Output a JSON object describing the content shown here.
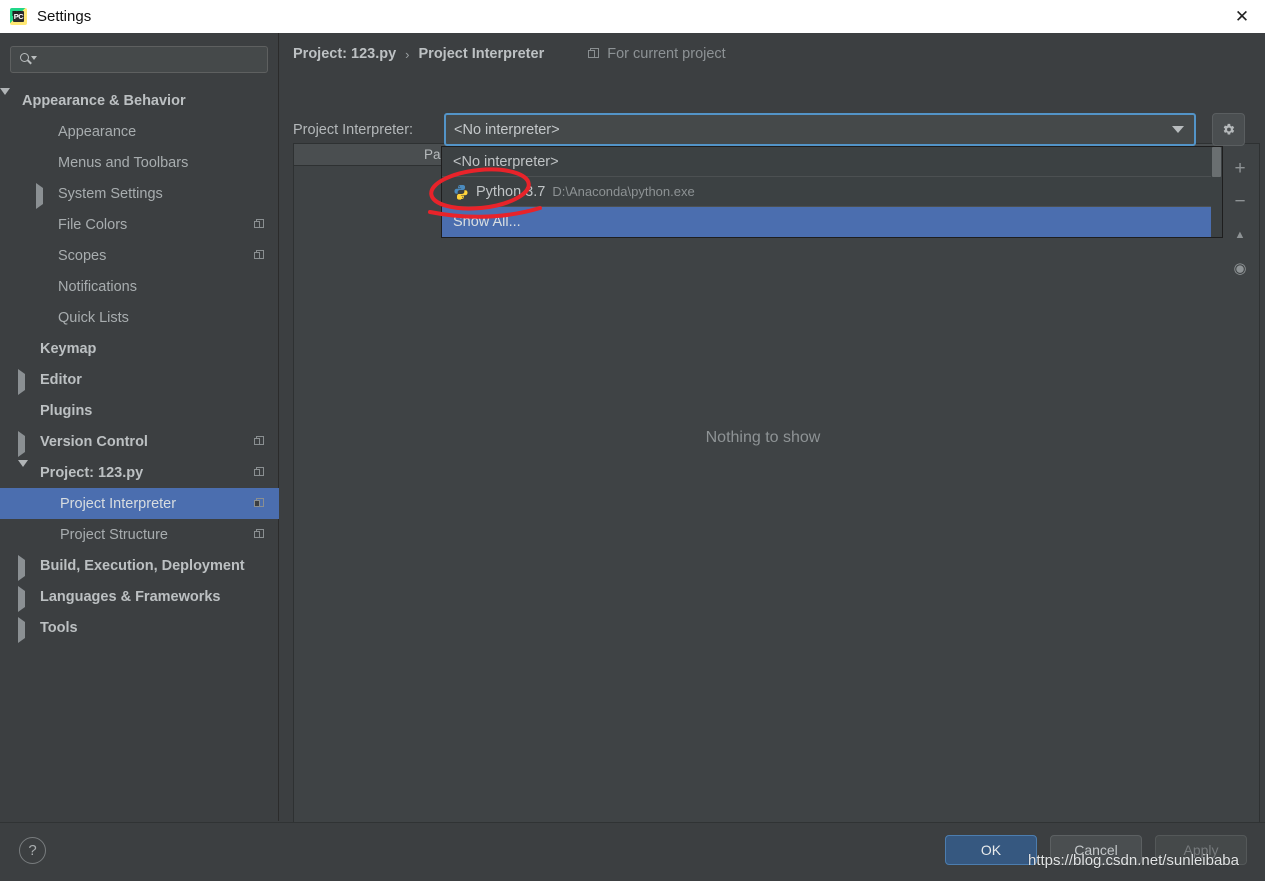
{
  "window": {
    "title": "Settings",
    "app_icon": "pycharm-icon",
    "close_icon": "close-icon"
  },
  "sidebar": {
    "search": {
      "placeholder": "",
      "value": "",
      "icon": "search-dropdown-icon"
    },
    "items": [
      {
        "label": "Appearance & Behavior",
        "indent": 22,
        "arrow": "down",
        "bold": true,
        "badge": false,
        "selected": false
      },
      {
        "label": "Appearance",
        "indent": 58,
        "arrow": "none",
        "bold": false,
        "badge": false,
        "selected": false
      },
      {
        "label": "Menus and Toolbars",
        "indent": 58,
        "arrow": "none",
        "bold": false,
        "badge": false,
        "selected": false
      },
      {
        "label": "System Settings",
        "indent": 58,
        "arrow": "right",
        "bold": false,
        "badge": false,
        "selected": false
      },
      {
        "label": "File Colors",
        "indent": 58,
        "arrow": "none",
        "bold": false,
        "badge": true,
        "selected": false
      },
      {
        "label": "Scopes",
        "indent": 58,
        "arrow": "none",
        "bold": false,
        "badge": true,
        "selected": false
      },
      {
        "label": "Notifications",
        "indent": 58,
        "arrow": "none",
        "bold": false,
        "badge": false,
        "selected": false
      },
      {
        "label": "Quick Lists",
        "indent": 58,
        "arrow": "none",
        "bold": false,
        "badge": false,
        "selected": false
      },
      {
        "label": "Keymap",
        "indent": 40,
        "arrow": "none",
        "bold": true,
        "badge": false,
        "selected": false
      },
      {
        "label": "Editor",
        "indent": 40,
        "arrow": "right",
        "bold": true,
        "badge": false,
        "selected": false
      },
      {
        "label": "Plugins",
        "indent": 40,
        "arrow": "none",
        "bold": true,
        "badge": false,
        "selected": false
      },
      {
        "label": "Version Control",
        "indent": 40,
        "arrow": "right",
        "bold": true,
        "badge": true,
        "selected": false
      },
      {
        "label": "Project: 123.py",
        "indent": 40,
        "arrow": "down",
        "bold": true,
        "badge": true,
        "selected": false
      },
      {
        "label": "Project Interpreter",
        "indent": 60,
        "arrow": "none",
        "bold": false,
        "badge": true,
        "selected": true
      },
      {
        "label": "Project Structure",
        "indent": 60,
        "arrow": "none",
        "bold": false,
        "badge": true,
        "selected": false
      },
      {
        "label": "Build, Execution, Deployment",
        "indent": 40,
        "arrow": "right",
        "bold": true,
        "badge": false,
        "selected": false
      },
      {
        "label": "Languages & Frameworks",
        "indent": 40,
        "arrow": "right",
        "bold": true,
        "badge": false,
        "selected": false
      },
      {
        "label": "Tools",
        "indent": 40,
        "arrow": "right",
        "bold": true,
        "badge": false,
        "selected": false
      }
    ]
  },
  "breadcrumb": {
    "root": "Project: 123.py",
    "separator": "›",
    "leaf": "Project Interpreter",
    "scope_note": "For current project",
    "scope_icon": "copy-scope-icon"
  },
  "interpreter": {
    "label": "Project Interpreter:",
    "selected_value": "<No interpreter>",
    "dropdown_arrow_icon": "chevron-down-icon",
    "gear_icon": "gear-icon",
    "options": [
      {
        "name": "<No interpreter>",
        "path": "",
        "icon": "none",
        "selected": false
      },
      {
        "name": "Python 3.7",
        "path": "D:\\Anaconda\\python.exe",
        "icon": "python-icon",
        "selected": false
      },
      {
        "name": "Show All...",
        "path": "",
        "icon": "none",
        "selected": true
      }
    ]
  },
  "packages": {
    "column_header": "Package",
    "empty_message": "Nothing to show",
    "tools": [
      {
        "icon": "plus-icon",
        "glyph": "+"
      },
      {
        "icon": "minus-icon",
        "glyph": "−"
      },
      {
        "icon": "upgrade-arrow-icon",
        "glyph": "▲"
      },
      {
        "icon": "eye-icon",
        "glyph": "◉"
      }
    ]
  },
  "footer": {
    "help_label": "?",
    "help_icon": "help-icon",
    "ok_label": "OK",
    "cancel_label": "Cancel",
    "apply_label": "Apply"
  },
  "annotation": {
    "watermark": "https://blog.csdn.net/sunleibaba",
    "highlight_color": "#e8232a",
    "highlight_target": "Show All..."
  }
}
